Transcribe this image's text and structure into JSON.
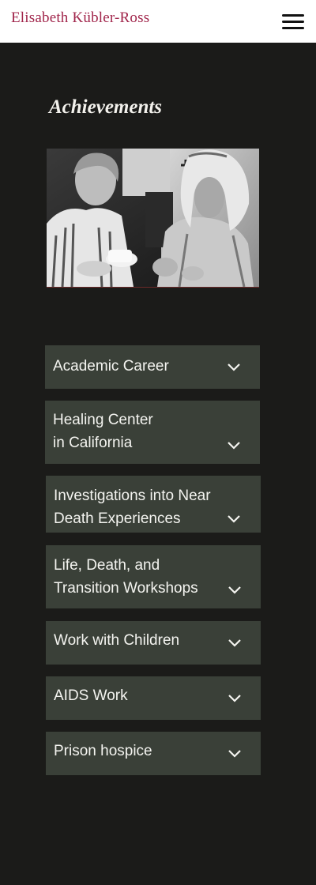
{
  "header": {
    "site_title": "Elisabeth Kübler-Ross",
    "menu_icon": "hamburger-menu-icon"
  },
  "main": {
    "section_title": "Achievements",
    "accordion": [
      {
        "line1": "Academic Career",
        "line2": "",
        "icon": "chevron-down-icon"
      },
      {
        "line1": "Healing Center",
        "line2": "in California",
        "icon": "chevron-down-icon"
      },
      {
        "line1": "Investigations into Near",
        "line2": "Death Experiences",
        "icon": "chevron-down-icon"
      },
      {
        "line1": "Life, Death, and",
        "line2": "Transition Workshops",
        "icon": "chevron-down-icon"
      },
      {
        "line1": "Work with Children",
        "line2": "",
        "icon": "chevron-down-icon"
      },
      {
        "line1": "AIDS Work",
        "line2": "",
        "icon": "chevron-down-icon"
      },
      {
        "line1": "Prison hospice",
        "line2": "",
        "icon": "chevron-down-icon"
      }
    ]
  },
  "colors": {
    "brand": "#a0244a",
    "background": "#1b1b19",
    "accordion_bg": "#3a4038",
    "text": "#f4f4f0"
  }
}
